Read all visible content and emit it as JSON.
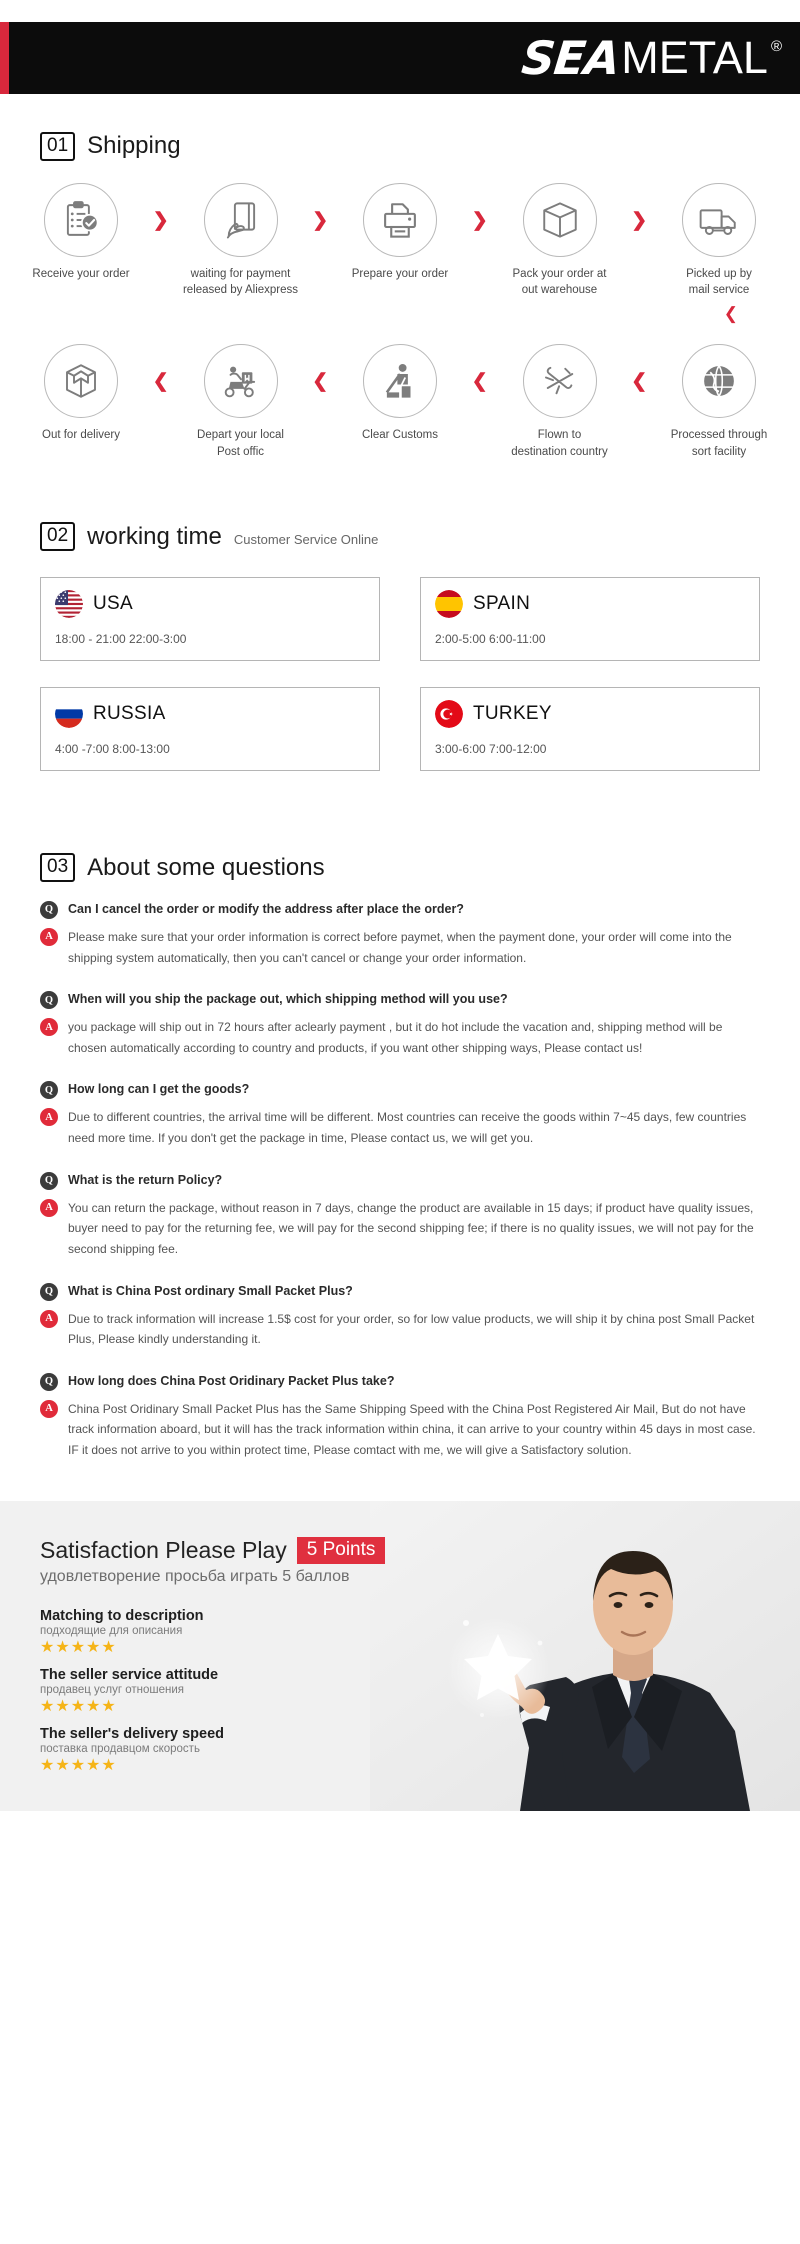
{
  "header": {
    "logo_sea": "SEA",
    "logo_metal": "METAL",
    "logo_reg": "®"
  },
  "shipping": {
    "number": "01",
    "title": "Shipping",
    "row1": [
      {
        "icon": "clipboard-check-icon",
        "label": "Receive your order"
      },
      {
        "icon": "hand-card-icon",
        "label": "waiting for payment\nreleased by Aliexpress"
      },
      {
        "icon": "printer-icon",
        "label": "Prepare your order"
      },
      {
        "icon": "box-icon",
        "label": "Pack your order at\nout warehouse"
      },
      {
        "icon": "truck-icon",
        "label": "Picked up by\nmail service"
      }
    ],
    "row2": [
      {
        "icon": "open-box-icon",
        "label": "Out  for delivery"
      },
      {
        "icon": "scooter-courier-icon",
        "label": "Depart your local\nPost offic"
      },
      {
        "icon": "customs-officer-icon",
        "label": "Clear Customs"
      },
      {
        "icon": "airplane-icon",
        "label": "Flown to\ndestination country"
      },
      {
        "icon": "globe-icon",
        "label": "Processed through\nsort facility"
      }
    ],
    "chevron_right": "❯",
    "chevron_left": "❮",
    "chevron_down": "❮"
  },
  "working_time": {
    "number": "02",
    "title": "working time",
    "subtitle": "Customer Service Online",
    "cards": [
      {
        "flag": "flag-usa-icon",
        "country": "USA",
        "hours": "18:00 - 21:00   22:00-3:00"
      },
      {
        "flag": "flag-spain-icon",
        "country": "SPAIN",
        "hours": "2:00-5:00     6:00-11:00"
      },
      {
        "flag": "flag-russia-icon",
        "country": "RUSSIA",
        "hours": "4:00 -7:00   8:00-13:00"
      },
      {
        "flag": "flag-turkey-icon",
        "country": "TURKEY",
        "hours": "3:00-6:00    7:00-12:00"
      }
    ]
  },
  "faq": {
    "number": "03",
    "title": "About some questions",
    "q_badge": "Q",
    "a_badge": "A",
    "items": [
      {
        "q": "Can I cancel the order or modify the address after place the order?",
        "a": "Please make sure that your order information is correct before paymet, when the payment done, your order will come into the shipping system automatically, then you can't cancel or change your order information."
      },
      {
        "q": "When will you ship the package out, which shipping method will you use?",
        "a": "you package will ship out in 72 hours after aclearly payment , but it do hot include the vacation and, shipping method will be chosen automatically according to country and products, if you want other shipping ways, Please contact us!"
      },
      {
        "q": "How long can I get the goods?",
        "a": "Due to different countries, the arrival time will be different. Most countries can receive the goods within 7~45 days, few countries need more time. If you don't get the package in time, Please contact us, we will get you."
      },
      {
        "q": "What is the return Policy?",
        "a": "You can return the package, without reason in 7 days, change the product are available in 15 days; if product have quality issues, buyer need to pay for the returning fee, we will pay for the second shipping fee; if there is no quality issues, we will not pay for the second shipping fee."
      },
      {
        "q": "What is China Post ordinary Small Packet Plus?",
        "a": "Due to track information will increase 1.5$ cost for your order, so for low value products, we will ship it by china post Small Packet Plus, Please kindly understanding it."
      },
      {
        "q": "How long does China Post Oridinary Packet Plus take?",
        "a": "China Post Oridinary Small Packet Plus has the Same Shipping Speed with the China Post Registered Air Mail, But do not have track information aboard, but it will has the track information within china, it can arrive to your country within 45 days in most case. IF it does not arrive to you within protect time, Please comtact with me, we will give a Satisfactory solution."
      }
    ]
  },
  "satisfaction": {
    "title": "Satisfaction Please Play",
    "points_badge": "5 Points",
    "subtitle": "удовлетворение просьба играть 5 баллов",
    "rows": [
      {
        "title": "Matching to description",
        "sub": "подходящие для описания",
        "stars": "★★★★★"
      },
      {
        "title": "The seller service attitude",
        "sub": "продавец услуг отношения",
        "stars": "★★★★★"
      },
      {
        "title": "The seller's delivery speed",
        "sub": "поставка продавцом скорость",
        "stars": "★★★★★"
      }
    ]
  },
  "colors": {
    "accent_red": "#d8283c",
    "badge_red": "#e02b3a",
    "star_gold": "#f5b417",
    "header_black": "#0c0c0c"
  }
}
